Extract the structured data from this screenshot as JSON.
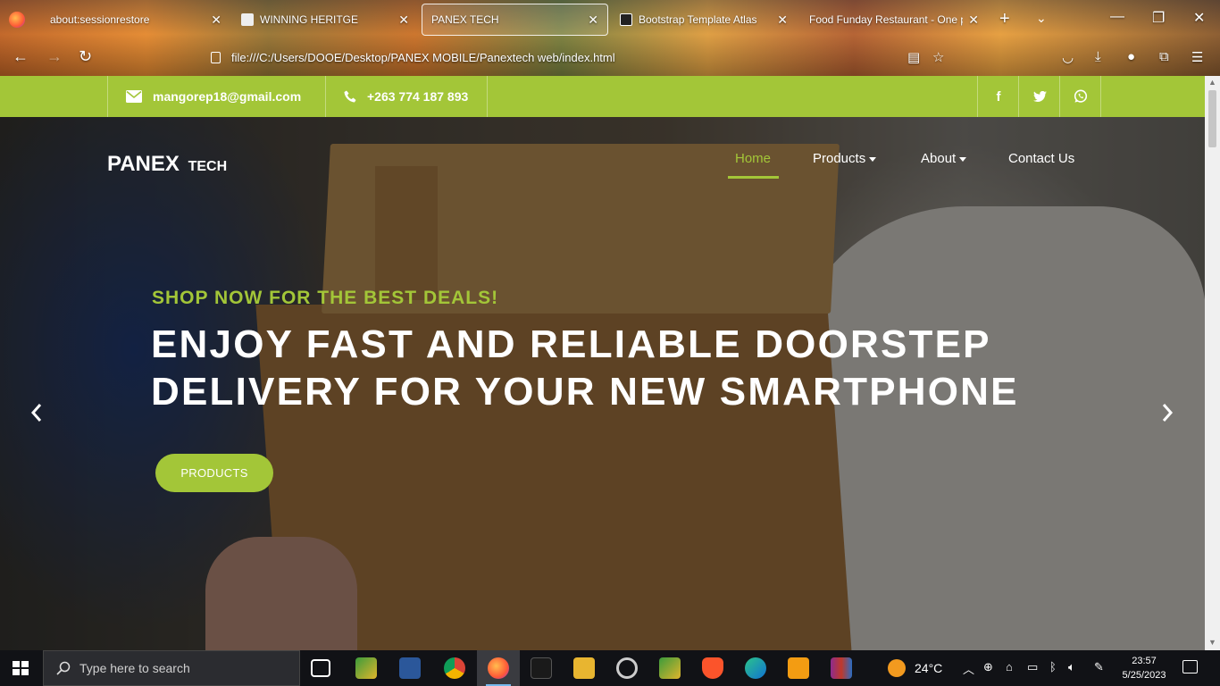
{
  "browser": {
    "tabs": [
      {
        "title": "about:sessionrestore",
        "active": false
      },
      {
        "title": "WINNING HERITGE",
        "active": false
      },
      {
        "title": "PANEX TECH",
        "active": true
      },
      {
        "title": "Bootstrap Template Atlas",
        "active": false
      },
      {
        "title": "Food Funday Restaurant - One pa",
        "active": false
      }
    ],
    "url": "file:///C:/Users/DOOE/Desktop/PANEX MOBILE/Panextech web/index.html"
  },
  "site": {
    "topbar": {
      "email": "mangorep18@gmail.com",
      "phone": "+263 774 187 893",
      "social": {
        "facebook": "f",
        "twitter": "twitter-icon",
        "whatsapp": "whatsapp-icon"
      },
      "color": "#a3c638"
    },
    "brand": {
      "main": "PANEX",
      "sub": "TECH"
    },
    "nav": [
      {
        "label": "Home",
        "active": true,
        "dropdown": false
      },
      {
        "label": "Products",
        "active": false,
        "dropdown": true
      },
      {
        "label": "About",
        "active": false,
        "dropdown": true
      },
      {
        "label": "Contact Us",
        "active": false,
        "dropdown": false
      }
    ],
    "hero": {
      "subheading": "SHOP NOW FOR THE BEST DEALS!",
      "heading": "ENJOY FAST AND RELIABLE DOORSTEP DELIVERY FOR YOUR NEW SMARTPHONE",
      "cta": "PRODUCTS"
    }
  },
  "taskbar": {
    "search_placeholder": "Type here to search",
    "weather": "24°C",
    "time": "23:57",
    "date": "5/25/2023"
  }
}
